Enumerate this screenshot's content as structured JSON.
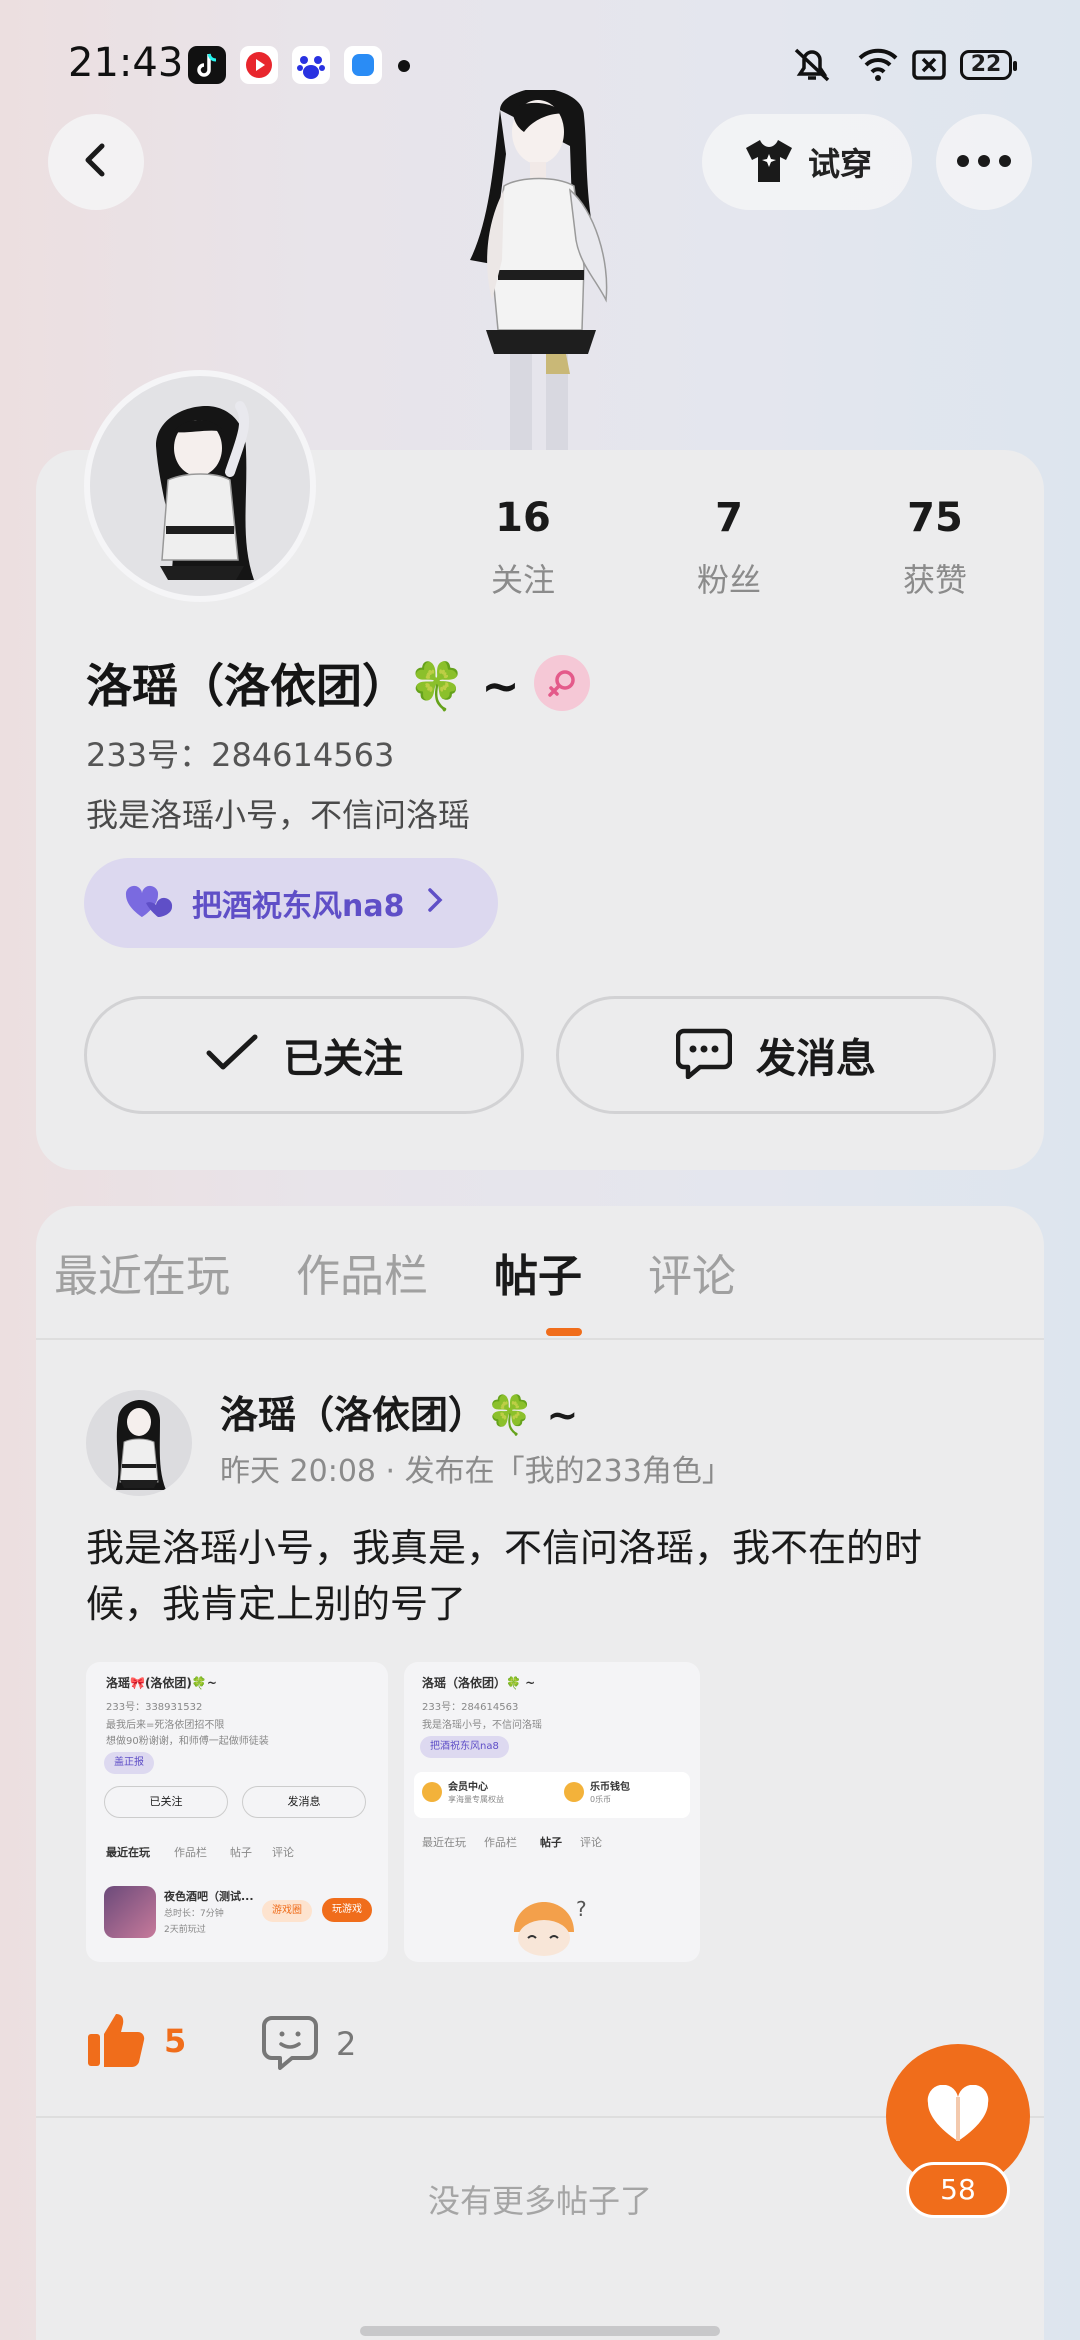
{
  "status_bar": {
    "time": "21:43",
    "battery": "22",
    "apps": [
      "tiktok-icon",
      "video-icon",
      "baidu-icon",
      "app-icon"
    ]
  },
  "header": {
    "try_on_label": "试穿"
  },
  "profile": {
    "stats": [
      {
        "value": "16",
        "label": "关注"
      },
      {
        "value": "7",
        "label": "粉丝"
      },
      {
        "value": "75",
        "label": "获赞"
      }
    ],
    "name": "洛瑶（洛依团）🍀 ~",
    "uid": "233号：284614563",
    "bio": "我是洛瑶小号，不信问洛瑶",
    "tag_label": "把酒祝东风na8",
    "follow_label": "已关注",
    "message_label": "发消息"
  },
  "tabs": [
    {
      "label": "最近在玩"
    },
    {
      "label": "作品栏"
    },
    {
      "label": "帖子"
    },
    {
      "label": "评论"
    }
  ],
  "post": {
    "author": "洛瑶（洛依团）🍀 ~",
    "meta": "昨天 20:08 · 发布在「我的233角色」",
    "text": "我是洛瑶小号，我真是，不信问洛瑶，我不在的时候，我肯定上别的号了",
    "likes": "5",
    "comments": "2"
  },
  "screenshot1": {
    "name": "洛瑶🎀(洛依团)🍀~",
    "uid": "233号：338931532",
    "line1": "最我后来=死洛依团招不限",
    "line2": "想做90粉谢谢，和师傅一起做师徒装",
    "tag": "盖正报",
    "follow": "已关注",
    "message": "发消息",
    "tabs": [
      "最近在玩",
      "作品栏",
      "帖子",
      "评论"
    ],
    "game_title": "夜色酒吧（测试...",
    "game_sub1": "总时长：7分钟",
    "game_sub2": "2天前玩过",
    "game_btn1": "游戏圈",
    "game_btn2": "玩游戏"
  },
  "screenshot2": {
    "name": "洛瑶（洛依团）🍀 ~",
    "uid": "233号：284614563",
    "bio": "我是洛瑶小号，不信问洛瑶",
    "tag": "把酒祝东风na8",
    "member_title": "会员中心",
    "member_sub": "享海量专属权益",
    "wallet_title": "乐币钱包",
    "wallet_sub": "0乐币",
    "tabs": [
      "最近在玩",
      "作品栏",
      "帖子",
      "评论"
    ]
  },
  "footer": {
    "no_more": "没有更多帖子了",
    "float_count": "58"
  },
  "colors": {
    "accent": "#f06d1b",
    "tag_text": "#5f4fc7",
    "tag_bg": "#dcd8ef"
  }
}
